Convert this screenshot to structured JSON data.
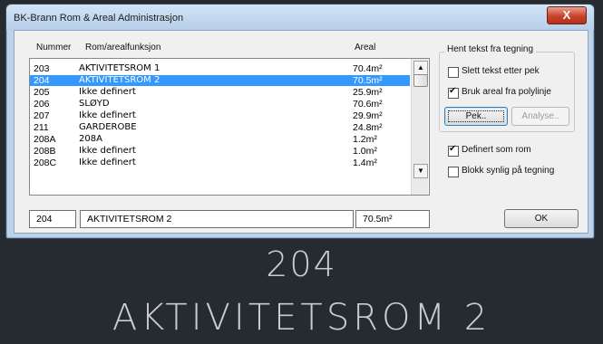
{
  "window": {
    "title": "BK-Brann Rom & Areal Administrasjon",
    "close_label": "X"
  },
  "list": {
    "headers": {
      "number": "Nummer",
      "name": "Rom/arealfunksjon",
      "area": "Areal"
    },
    "rows": [
      {
        "number": "203",
        "name": "AKTIVITETSROM 1",
        "area": "70.4m²",
        "selected": false
      },
      {
        "number": "204",
        "name": "AKTIVITETSROM 2",
        "area": "70.5m²",
        "selected": true
      },
      {
        "number": "205",
        "name": "Ikke definert",
        "area": "25.9m²",
        "selected": false
      },
      {
        "number": "206",
        "name": "SLØYD",
        "area": "70.6m²",
        "selected": false
      },
      {
        "number": "207",
        "name": "Ikke definert",
        "area": "29.9m²",
        "selected": false
      },
      {
        "number": "211",
        "name": "GARDEROBE",
        "area": "24.8m²",
        "selected": false
      },
      {
        "number": "208A",
        "name": "208A",
        "area": "1.2m²",
        "selected": false
      },
      {
        "number": "208B",
        "name": "Ikke definert",
        "area": "1.0m²",
        "selected": false
      },
      {
        "number": "208C",
        "name": "Ikke definert",
        "area": "1.4m²",
        "selected": false
      }
    ],
    "scroll_up_icon": "▲",
    "scroll_down_icon": "▼"
  },
  "fields": {
    "number": "204",
    "name": "AKTIVITETSROM 2",
    "area": "70.5m²"
  },
  "options": {
    "group_title": "Hent tekst fra tegning",
    "slett_label": "Slett tekst etter pek",
    "slett_checked": false,
    "bruk_label": "Bruk areal fra polylinje",
    "bruk_checked": true,
    "pek_label": "Pek..",
    "analyse_label": "Analyse..",
    "definert_label": "Definert som rom",
    "definert_checked": true,
    "blokk_label": "Blokk synlig på tegning",
    "blokk_checked": false
  },
  "ok_label": "OK",
  "drawing": {
    "number": "204",
    "name": "AKTIVITETSROM  2"
  },
  "colors": {
    "selection": "#3399ff",
    "cad_background": "#262a31",
    "close_button": "#c8432b"
  }
}
